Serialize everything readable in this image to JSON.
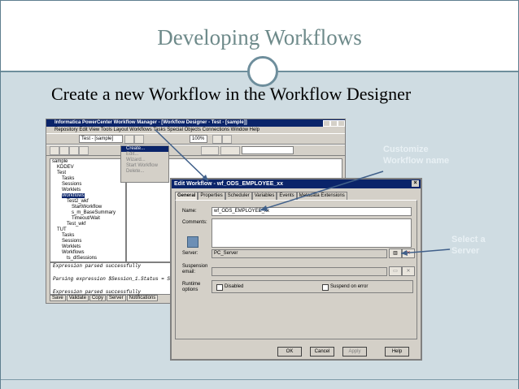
{
  "slide": {
    "title": "Developing Workflows",
    "subtitle": "Create a new Workflow in the Workflow Designer"
  },
  "main_window": {
    "title": "Informatica PowerCenter Workflow Manager - [Workflow Designer - Test - [sample]]",
    "menu": "Repository  Edit  View  Tools  Layout  Workflows  Tasks  Special Objects  Connections  Window  Help",
    "repo_combo": "Test - [sample]",
    "zoom": "100%",
    "workflow_menu": [
      "Create...",
      "Edit...",
      "Wizard...",
      "Start Workflow",
      "Delete..."
    ],
    "nav_tree": [
      "sample",
      "KDDEV",
      "Test",
      "Tasks",
      "Sessions",
      "Worklets",
      "Workflows",
      "Test2_wkf",
      "StartWorkflow",
      "s_m_BaseSummary",
      "Timeout/Wait",
      "Test_wkf",
      "TUT",
      "Tasks",
      "Sessions",
      "Worklets",
      "Workflows",
      "ts_dlSessions"
    ],
    "output_lines": [
      "Expression parsed successfully",
      "Parsing expression $Session_1.Status = SUCC",
      "Expression parsed successfully"
    ],
    "output_tabs": [
      "Save",
      "Validate",
      "Copy",
      "Server",
      "Notifications"
    ]
  },
  "dialog": {
    "title": "Edit Workflow - wf_ODS_EMPLOYEE_xx",
    "tabs": [
      "General",
      "Properties",
      "Scheduler",
      "Variables",
      "Events",
      "Metadata Extensions"
    ],
    "name_label": "Name:",
    "name_value": "wf_ODS_EMPLOYEE_xx",
    "comments_label": "Comments:",
    "server_label": "Server:",
    "server_value": "PC_Server",
    "suspension_label": "Suspension email:",
    "runtime_label": "Runtime options",
    "disabled_label": "Disabled",
    "suspend_label": "Suspend on error",
    "buttons": [
      "OK",
      "Cancel",
      "Apply",
      "Help"
    ]
  },
  "callouts": {
    "customize": "Customize Workflow name",
    "select_server": "Select a Server"
  }
}
